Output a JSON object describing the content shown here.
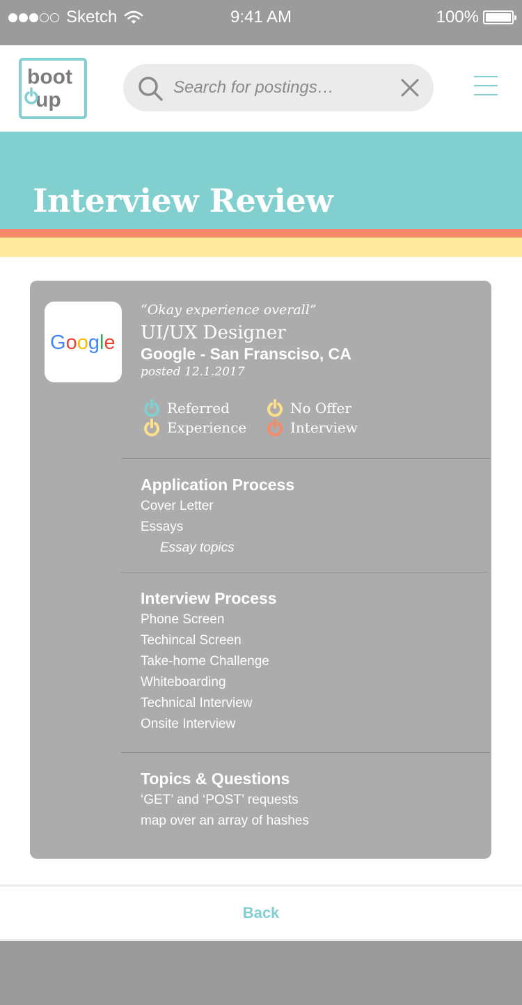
{
  "status_bar": {
    "carrier": "Sketch",
    "time": "9:41 AM",
    "battery": "100%"
  },
  "header": {
    "logo_text_top": "boot",
    "logo_text_bottom": "up",
    "search_placeholder": "Search for postings…",
    "brand_color": "#82cfd0"
  },
  "page": {
    "title": "Interview Review"
  },
  "review": {
    "quote": "“Okay experience overall”",
    "job_title": "UI/UX Designer",
    "company_location": "Google - San Fransciso, CA",
    "posted": "posted 12.1.2017",
    "company_logo_text": "Google",
    "tags": [
      {
        "label": "Referred",
        "color": "#82cfd0"
      },
      {
        "label": "No Offer",
        "color": "#ffe08a"
      },
      {
        "label": "Experience",
        "color": "#ffe08a"
      },
      {
        "label": "Interview",
        "color": "#f48a6a"
      }
    ],
    "sections": [
      {
        "title": "Application Process",
        "items": [
          "Cover Letter",
          "Essays"
        ],
        "sub_items": [
          "Essay topics"
        ]
      },
      {
        "title": "Interview Process",
        "items": [
          "Phone Screen",
          "Techincal Screen",
          "Take-home Challenge",
          "Whiteboarding",
          "Technical Interview",
          "Onsite Interview"
        ]
      },
      {
        "title": "Topics & Questions",
        "items": [
          "‘GET’ and ‘POST’ requests",
          "map over an array of hashes"
        ]
      }
    ]
  },
  "footer": {
    "back_label": "Back"
  }
}
